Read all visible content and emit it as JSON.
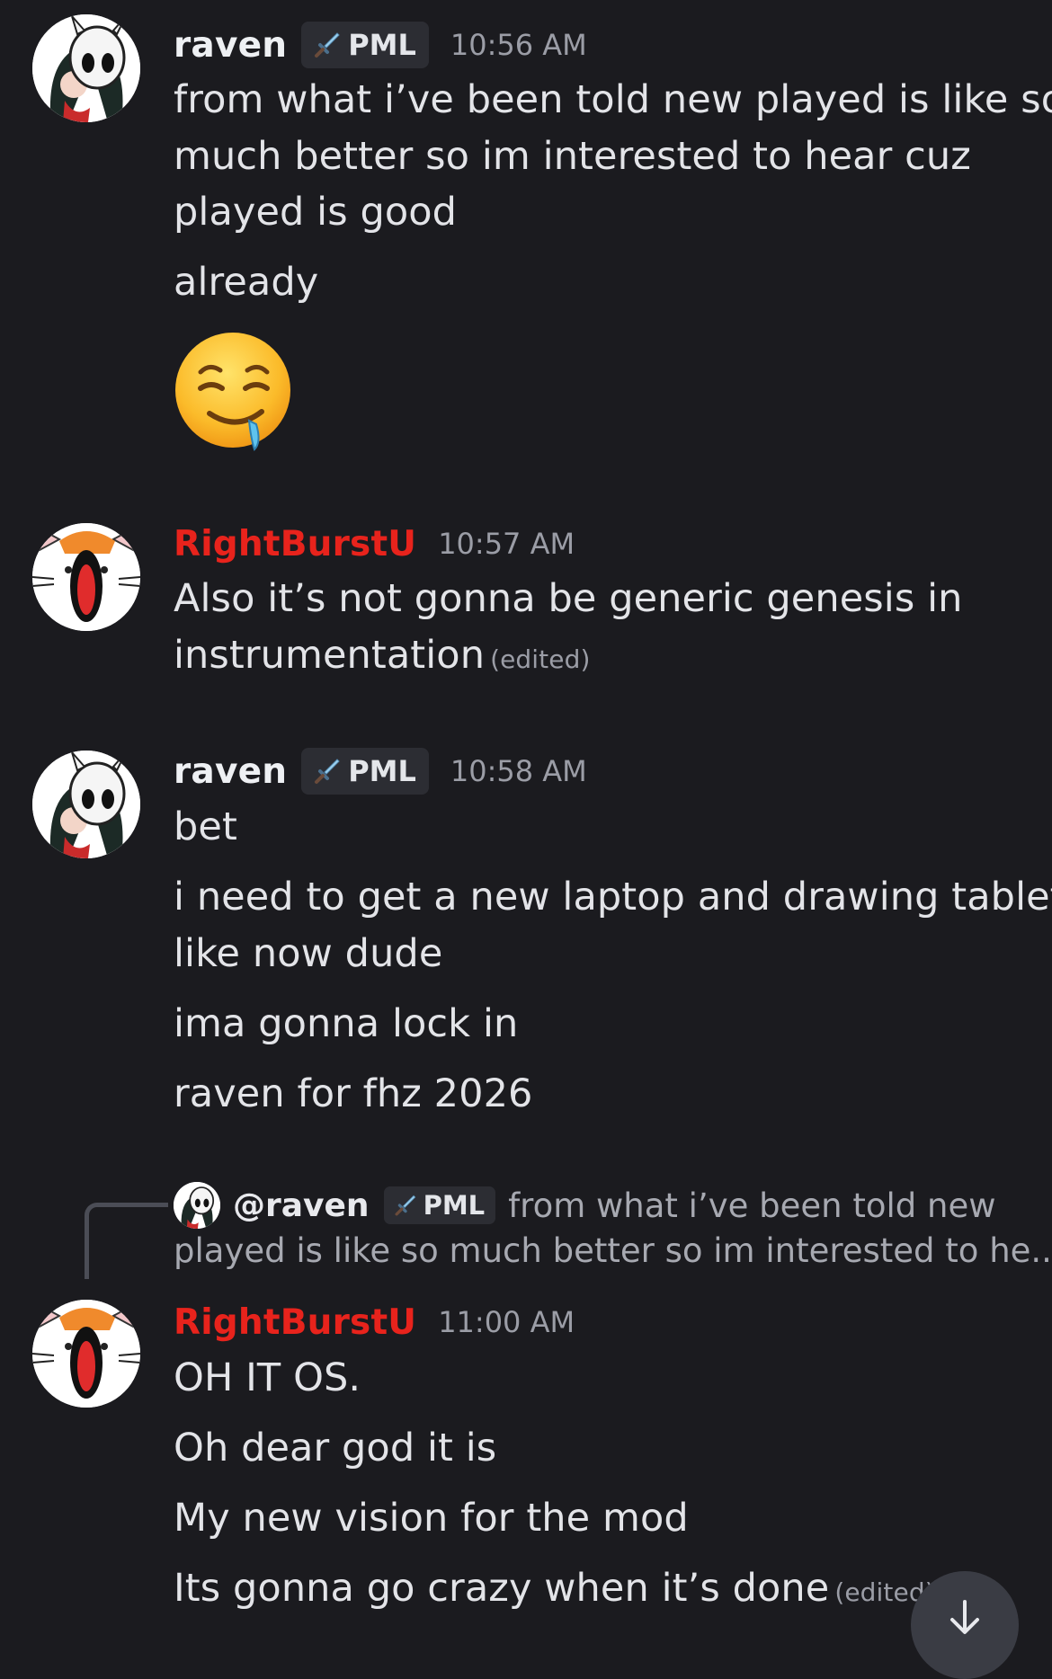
{
  "messages": [
    {
      "username": "raven",
      "tag": "PML",
      "time": "10:56 AM",
      "lines": [
        "from what i’ve been told new played is like so",
        "much better so im interested to hear cuz",
        "played is good",
        "already"
      ],
      "emoji": "drooling-face"
    },
    {
      "username": "RightBurstU",
      "time": "10:57 AM",
      "lines": [
        "Also it’s not gonna be generic genesis in",
        "instrumentation"
      ],
      "edited": "(edited)"
    },
    {
      "username": "raven",
      "tag": "PML",
      "time": "10:58 AM",
      "lines": [
        "bet",
        "i need to get a new laptop and drawing tablet",
        "like now dude",
        "ima gonna lock in",
        "raven for fhz 2026"
      ]
    },
    {
      "reply": {
        "user": "@raven",
        "tag": "PML",
        "text1": "from what i’ve been told new",
        "text2": "played is like so much better so im interested to he..."
      },
      "username": "RightBurstU",
      "time": "11:00 AM",
      "lines": [
        "OH IT OS.",
        "Oh dear god it is",
        "My new vision for the mod",
        "Its gonna go crazy when it’s done"
      ],
      "edited": "(edited)"
    }
  ],
  "colors": {
    "background": "#1b1b1f",
    "username_red": "#e8231c",
    "text": "#e3e4e8",
    "muted": "#9b9da6"
  },
  "icons": [
    "sword-icon",
    "drooling-face-emoji",
    "arrow-down-icon"
  ]
}
